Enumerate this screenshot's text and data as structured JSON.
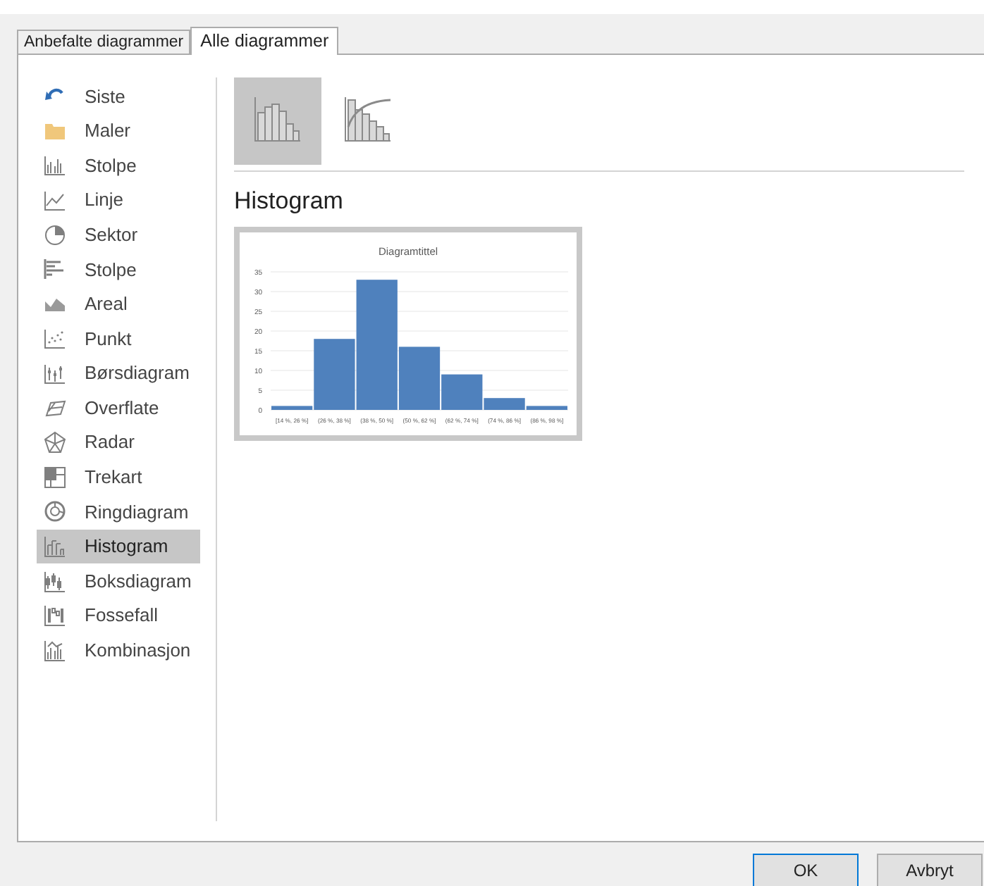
{
  "tabs": [
    {
      "label": "Anbefalte diagrammer",
      "selected": false
    },
    {
      "label": "Alle diagrammer",
      "selected": true
    }
  ],
  "sidebar": {
    "items": [
      {
        "label": "Siste",
        "selected": false
      },
      {
        "label": "Maler",
        "selected": false
      },
      {
        "label": "Stolpe",
        "selected": false
      },
      {
        "label": "Linje",
        "selected": false
      },
      {
        "label": "Sektor",
        "selected": false
      },
      {
        "label": "Stolpe",
        "selected": false
      },
      {
        "label": "Areal",
        "selected": false
      },
      {
        "label": "Punkt",
        "selected": false
      },
      {
        "label": "Børsdiagram",
        "selected": false
      },
      {
        "label": "Overflate",
        "selected": false
      },
      {
        "label": "Radar",
        "selected": false
      },
      {
        "label": "Trekart",
        "selected": false
      },
      {
        "label": "Ringdiagram",
        "selected": false
      },
      {
        "label": "Histogram",
        "selected": true
      },
      {
        "label": "Boksdiagram",
        "selected": false
      },
      {
        "label": "Fossefall",
        "selected": false
      },
      {
        "label": "Kombinasjon",
        "selected": false
      }
    ]
  },
  "subtypes": [
    {
      "kind": "histogram",
      "selected": true
    },
    {
      "kind": "pareto",
      "selected": false
    }
  ],
  "heading": "Histogram",
  "preview": {
    "chart_data": {
      "type": "bar",
      "title": "Diagramtittel",
      "categories": [
        "[14 %, 26 %]",
        "(26 %, 38 %]",
        "(38 %, 50 %]",
        "(50 %, 62 %]",
        "(62 %, 74 %]",
        "(74 %, 86 %]",
        "(86 %, 98 %]"
      ],
      "series": [
        {
          "color": "#4f81bd",
          "values": [
            1,
            18,
            33,
            16,
            9,
            3,
            1
          ]
        }
      ],
      "grid": true,
      "ylim": [
        0,
        35
      ],
      "yticks": [
        0,
        5,
        10,
        15,
        20,
        25,
        30,
        35
      ]
    }
  },
  "buttons": [
    "OK",
    "Avbryt"
  ]
}
